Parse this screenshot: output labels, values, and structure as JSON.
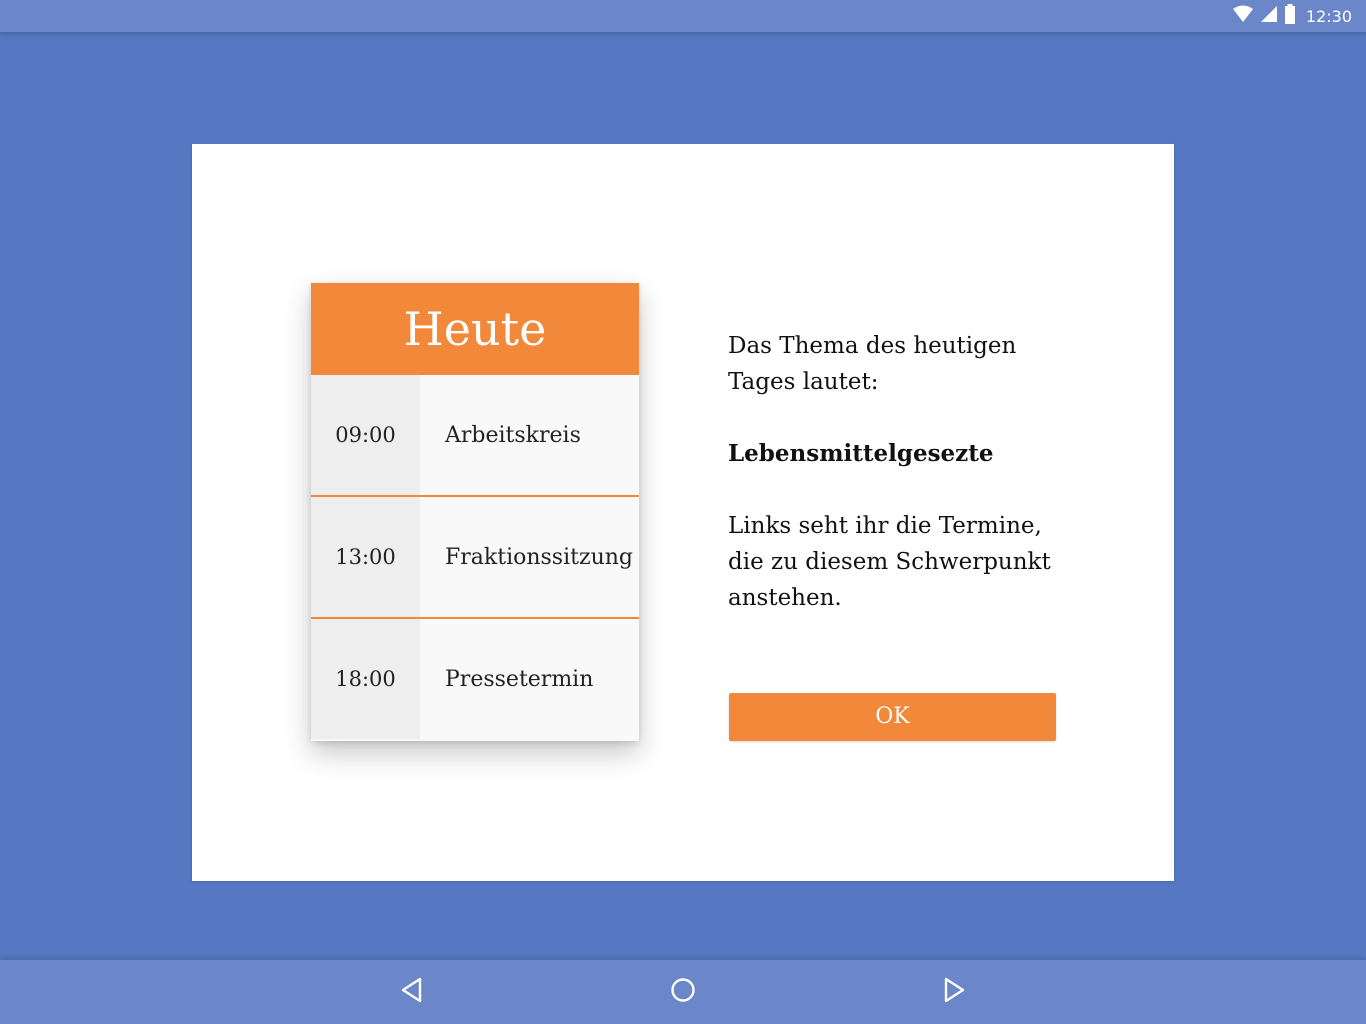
{
  "status_bar": {
    "time": "12:30",
    "icons": [
      "wifi-icon",
      "cell-signal-icon",
      "battery-icon"
    ]
  },
  "schedule": {
    "title": "Heute",
    "items": [
      {
        "time": "09:00",
        "label": "Arbeitskreis"
      },
      {
        "time": "13:00",
        "label": "Fraktionssitzung"
      },
      {
        "time": "18:00",
        "label": "Pressetermin"
      }
    ]
  },
  "info": {
    "intro": "Das Thema des heutigen Tages lautet:",
    "topic": "Lebensmittelgesezte",
    "explanation": "Links seht ihr die Termine, die zu diesem Schwerpunkt anstehen."
  },
  "ok_button": {
    "label": "OK"
  },
  "nav_bar": {
    "icons": [
      "back-icon",
      "home-icon",
      "recents-icon"
    ]
  },
  "colors": {
    "background": "#5677c1",
    "bars": "#6b86c9",
    "accent": "#f2883a",
    "card": "#ffffff"
  }
}
